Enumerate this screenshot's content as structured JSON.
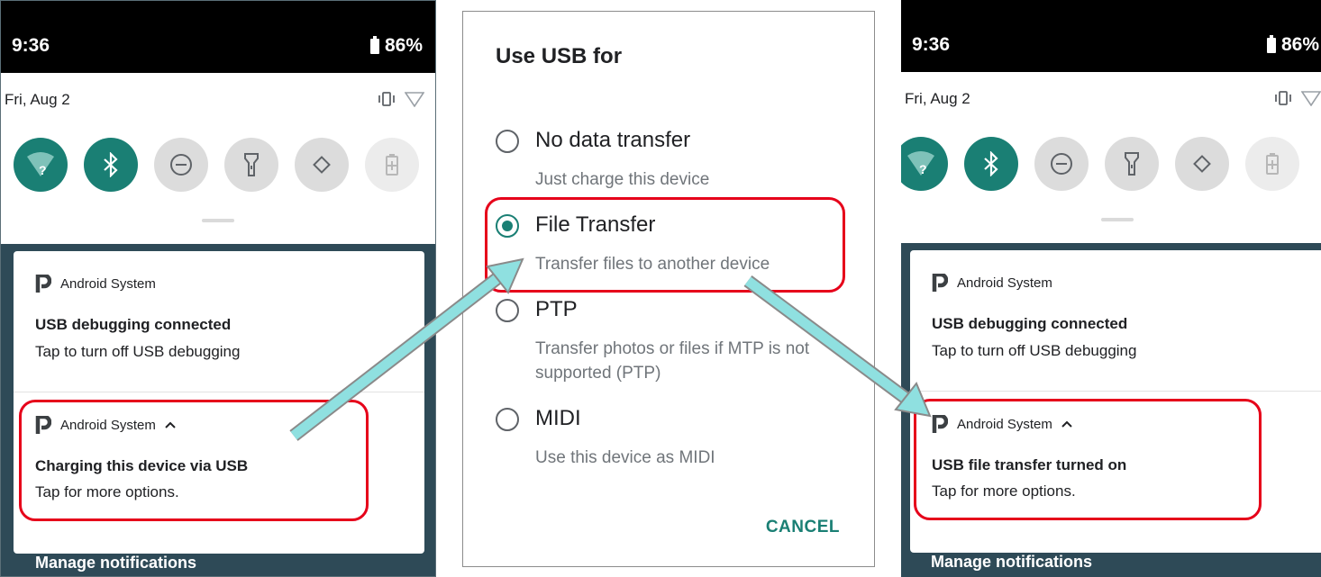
{
  "left_phone": {
    "status_bar": {
      "time": "9:36",
      "battery": "86%"
    },
    "quick_settings": {
      "date": "Fri, Aug 2"
    },
    "notifications": [
      {
        "app": "Android System",
        "title": "USB debugging connected",
        "text": "Tap to turn off USB debugging",
        "expanded": false
      },
      {
        "app": "Android System",
        "title": "Charging this device via USB",
        "text": "Tap for more options.",
        "expanded": true
      }
    ],
    "manage_label": "Manage notifications"
  },
  "dialog": {
    "title": "Use USB for",
    "options": [
      {
        "label": "No data transfer",
        "desc": "Just charge this device",
        "selected": false
      },
      {
        "label": "File Transfer",
        "desc": "Transfer files to another device",
        "selected": true
      },
      {
        "label": "PTP",
        "desc": "Transfer photos or files if MTP is not supported (PTP)",
        "selected": false
      },
      {
        "label": "MIDI",
        "desc": "Use this device as MIDI",
        "selected": false
      }
    ],
    "cancel_label": "CANCEL"
  },
  "right_phone": {
    "status_bar": {
      "time": "9:36",
      "battery": "86%"
    },
    "quick_settings": {
      "date": "Fri, Aug 2"
    },
    "notifications": [
      {
        "app": "Android System",
        "title": "USB debugging connected",
        "text": "Tap to turn off USB debugging",
        "expanded": false
      },
      {
        "app": "Android System",
        "title": "USB file transfer turned on",
        "text": "Tap for more options.",
        "expanded": true
      }
    ],
    "manage_label": "Manage notifications"
  },
  "icons": [
    "wifi-icon",
    "bluetooth-icon",
    "do-not-disturb-icon",
    "flashlight-icon",
    "auto-rotate-icon",
    "battery-saver-icon",
    "vibrate-icon",
    "wifi-signal-icon",
    "app-p-logo-icon",
    "expand-chevron-icon"
  ],
  "colors": {
    "accent": "#1a7f74",
    "highlight": "#e6001a",
    "arrow": "#8fe0e0",
    "shade_bg": "#2e4a57"
  }
}
